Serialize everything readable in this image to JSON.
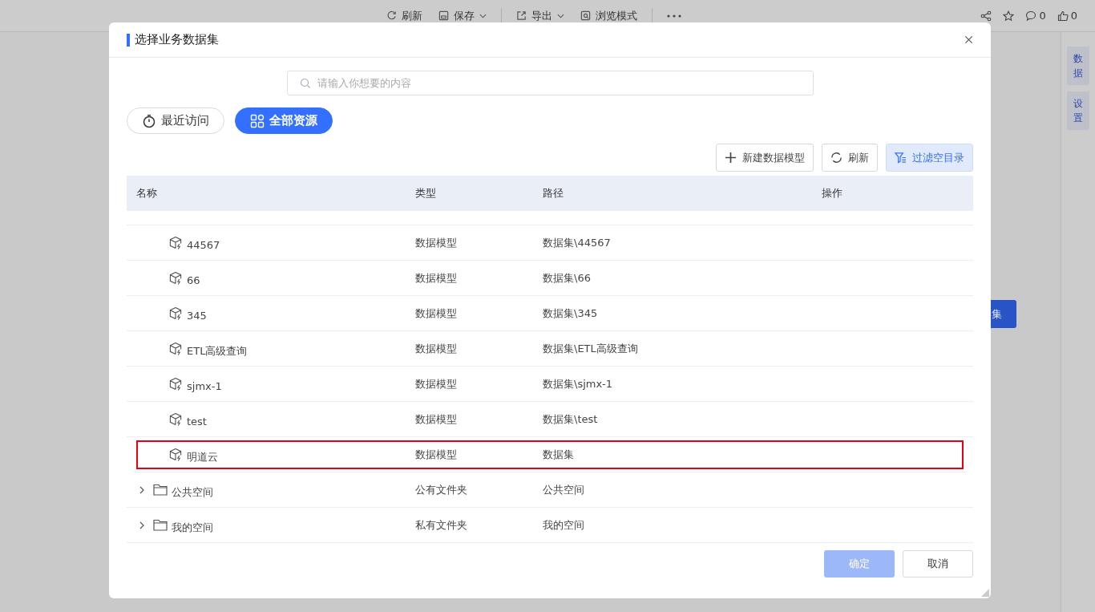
{
  "toolbar": {
    "items": [
      {
        "label": "刷新",
        "kind": "refresh",
        "dropdown": false
      },
      {
        "label": "保存",
        "kind": "save",
        "dropdown": true
      },
      {
        "label": "导出",
        "kind": "export",
        "dropdown": true
      },
      {
        "label": "浏览模式",
        "kind": "preview",
        "dropdown": false
      }
    ],
    "comments": "0",
    "likes": "0"
  },
  "side_tabs": [
    "数据",
    "设置"
  ],
  "background_button": "集",
  "dialog": {
    "title": "选择业务数据集",
    "search": {
      "placeholder": "请输入你想要的内容"
    },
    "tabs": [
      {
        "label": "最近访问",
        "kind": "recent",
        "selected": false
      },
      {
        "label": "全部资源",
        "kind": "all",
        "selected": true
      }
    ],
    "actions": [
      {
        "label": "新建数据模型",
        "kind": "add",
        "selected": false
      },
      {
        "label": "刷新",
        "kind": "refresh",
        "selected": false
      },
      {
        "label": "过滤空目录",
        "kind": "filter",
        "selected": true
      }
    ],
    "table": {
      "columns": [
        "名称",
        "类型",
        "路径",
        "操作"
      ],
      "rows": [
        {
          "kind": "model",
          "name": "44567",
          "type": "数据模型",
          "path": "数据集\\44567",
          "highlighted": false
        },
        {
          "kind": "model",
          "name": "66",
          "type": "数据模型",
          "path": "数据集\\66",
          "highlighted": false
        },
        {
          "kind": "model",
          "name": "345",
          "type": "数据模型",
          "path": "数据集\\345",
          "highlighted": false
        },
        {
          "kind": "model",
          "name": "ETL高级查询",
          "type": "数据模型",
          "path": "数据集\\ETL高级查询",
          "highlighted": false
        },
        {
          "kind": "model",
          "name": "sjmx-1",
          "type": "数据模型",
          "path": "数据集\\sjmx-1",
          "highlighted": false
        },
        {
          "kind": "model",
          "name": "test",
          "type": "数据模型",
          "path": "数据集\\test",
          "highlighted": false
        },
        {
          "kind": "model",
          "name": "明道云",
          "type": "数据模型",
          "path": "数据集",
          "highlighted": true
        },
        {
          "kind": "folder",
          "name": "公共空间",
          "type": "公有文件夹",
          "path": "公共空间",
          "expanded": false,
          "highlighted": false
        },
        {
          "kind": "folder",
          "name": "我的空间",
          "type": "私有文件夹",
          "path": "我的空间",
          "expanded": false,
          "highlighted": false
        }
      ]
    },
    "buttons": [
      {
        "label": "确定",
        "kind": "primary",
        "disabled": true
      },
      {
        "label": "取消",
        "kind": "default",
        "disabled": false
      }
    ]
  }
}
